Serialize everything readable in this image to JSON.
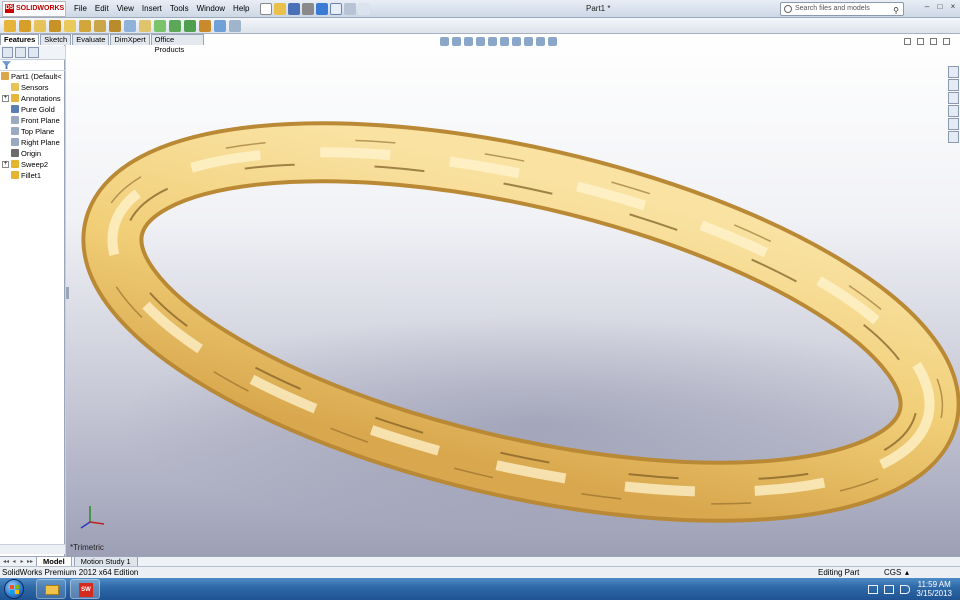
{
  "app": {
    "logo_text": "SOLIDWORKS",
    "menu": [
      "File",
      "Edit",
      "View",
      "Insert",
      "Tools",
      "Window",
      "Help"
    ],
    "document_title": "Part1 *",
    "search_placeholder": "Search files and models",
    "window_controls": [
      "–",
      "□",
      "×"
    ]
  },
  "feature_manager": {
    "tabs": [
      "Features",
      "Sketch",
      "Evaluate",
      "DimXpert",
      "Office Products"
    ],
    "tree": [
      {
        "label": "Part1  (Default<",
        "icon": "part-icon",
        "color": "#d9a64a",
        "expand": "",
        "root": true
      },
      {
        "label": "Sensors",
        "icon": "folder-icon",
        "color": "#e6c45a",
        "expand": ""
      },
      {
        "label": "Annotations",
        "icon": "annotations-icon",
        "color": "#e6b53c",
        "expand": "+"
      },
      {
        "label": "Pure Gold",
        "icon": "material-icon",
        "color": "#5b7fb5",
        "expand": ""
      },
      {
        "label": "Front Plane",
        "icon": "plane-icon",
        "color": "#9aaac0",
        "expand": ""
      },
      {
        "label": "Top Plane",
        "icon": "plane-icon",
        "color": "#9aaac0",
        "expand": ""
      },
      {
        "label": "Right Plane",
        "icon": "plane-icon",
        "color": "#9aaac0",
        "expand": ""
      },
      {
        "label": "Origin",
        "icon": "origin-icon",
        "color": "#6c6c6c",
        "expand": ""
      },
      {
        "label": "Sweep2",
        "icon": "sweep-icon",
        "color": "#e3b531",
        "expand": "+"
      },
      {
        "label": "Fillet1",
        "icon": "fillet-icon",
        "color": "#e3b531",
        "expand": ""
      }
    ]
  },
  "viewport": {
    "view_label": "*Trimetric",
    "model_color": "#f1cf78"
  },
  "bottom_tabs": {
    "nav": [
      "◂◂",
      "◂",
      "▸",
      "▸▸"
    ],
    "tabs": [
      "Model",
      "Motion Study 1"
    ]
  },
  "status": {
    "edition": "SolidWorks Premium 2012 x64 Edition",
    "mode": "Editing Part",
    "units": "CGS",
    "units_arrow": "▴"
  },
  "taskbar": {
    "time": "11:59 AM",
    "date": "3/15/2013",
    "sw_app_label": "SW"
  }
}
